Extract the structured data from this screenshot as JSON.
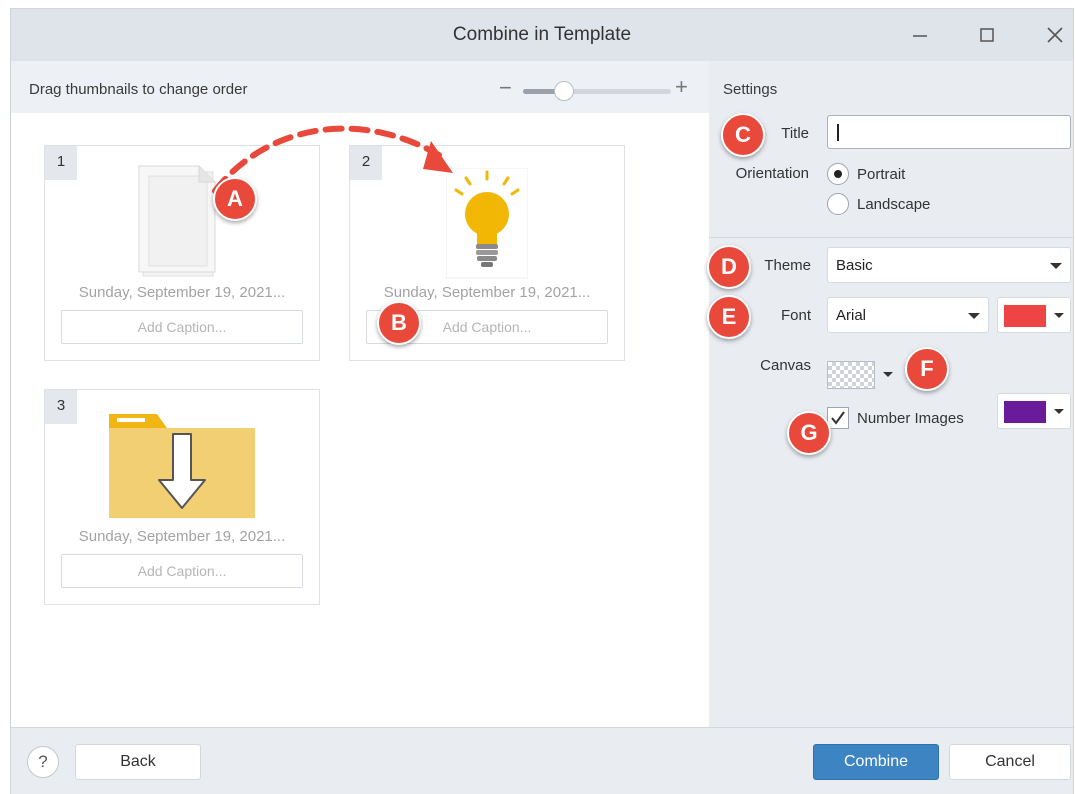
{
  "window": {
    "title": "Combine in Template"
  },
  "left": {
    "drag_hint": "Drag thumbnails to change order",
    "zoom": {
      "minus": "−",
      "plus": "+",
      "level": 0.28
    }
  },
  "thumbnails": [
    {
      "number": "1",
      "date": "Sunday, September 19, 2021...",
      "caption_placeholder": "Add Caption...",
      "image": "blank-document-icon"
    },
    {
      "number": "2",
      "date": "Sunday, September 19, 2021...",
      "caption_placeholder": "Add Caption...",
      "image": "lightbulb-icon"
    },
    {
      "number": "3",
      "date": "Sunday, September 19, 2021...",
      "caption_placeholder": "Add Caption...",
      "image": "folder-download-icon"
    }
  ],
  "settings": {
    "heading": "Settings",
    "title_label": "Title",
    "title_value": "",
    "orientation_label": "Orientation",
    "orientation_options": [
      "Portrait",
      "Landscape"
    ],
    "orientation_selected": "Portrait",
    "theme_label": "Theme",
    "theme_value": "Basic",
    "font_label": "Font",
    "font_value": "Arial",
    "font_color": "#ef4444",
    "canvas_label": "Canvas",
    "number_images_label": "Number Images",
    "number_images_checked": true,
    "number_color": "#6a1b9a"
  },
  "markers": [
    "A",
    "B",
    "C",
    "D",
    "E",
    "F",
    "G"
  ],
  "colors": {
    "accent": "#3d84c3",
    "marker": "#e8493b",
    "arrow": "#e8493b"
  },
  "footer": {
    "help": "?",
    "back": "Back",
    "combine": "Combine",
    "cancel": "Cancel"
  }
}
